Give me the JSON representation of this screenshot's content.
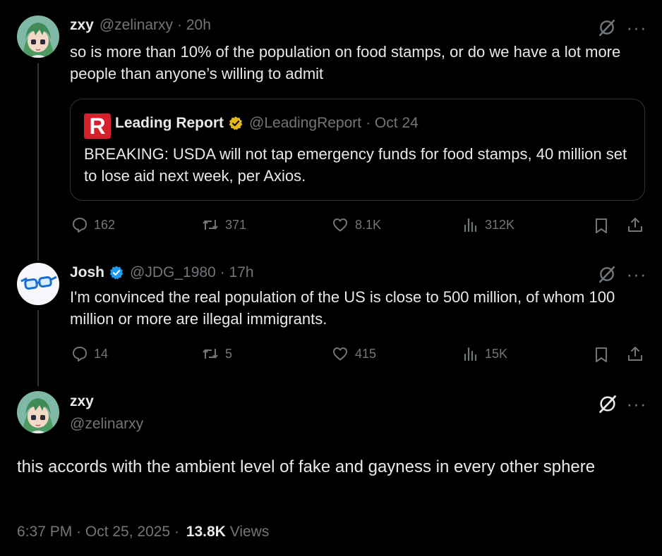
{
  "colors": {
    "background": "#000000",
    "text": "#e7e9ea",
    "muted": "#71767b",
    "verified_blue": "#1d9bf0",
    "verified_gold": "#e2b719",
    "leading_red": "#d4202a"
  },
  "post1": {
    "name": "zxy",
    "handle": "@zelinarxy",
    "time": "· 20h",
    "text": "so is more than 10% of the population on food stamps, or do we have a lot more people than anyone’s willing to admit",
    "more": "···",
    "quote": {
      "logo_letter": "R",
      "name": "Leading Report",
      "handle": "@LeadingReport",
      "time": "· Oct 24",
      "text": "BREAKING: USDA will not tap emergency funds for food stamps, 40 million set to lose aid next week, per Axios."
    },
    "stats": {
      "replies": "162",
      "reposts": "371",
      "likes": "8.1K",
      "views": "312K"
    }
  },
  "post2": {
    "name": "Josh",
    "handle": "@JDG_1980",
    "time": "· 17h",
    "text": "I'm convinced the real population of the US is close to 500 million, of whom 100 million or more are illegal immigrants.",
    "more": "···",
    "stats": {
      "replies": "14",
      "reposts": "5",
      "likes": "415",
      "views": "15K"
    }
  },
  "main": {
    "name": "zxy",
    "handle": "@zelinarxy",
    "more": "···",
    "text": "this accords with the ambient level of fake and gayness in every other sphere",
    "timestamp": "6:37 PM · Oct 25, 2025 ·",
    "views_count": "13.8K",
    "views_label": "Views"
  },
  "icons": [
    "anime-avatar-icon",
    "glasses-avatar-icon",
    "grok-icon",
    "reply-icon",
    "repost-icon",
    "like-icon",
    "views-icon",
    "bookmark-icon",
    "share-icon",
    "verified-badge-icon"
  ]
}
